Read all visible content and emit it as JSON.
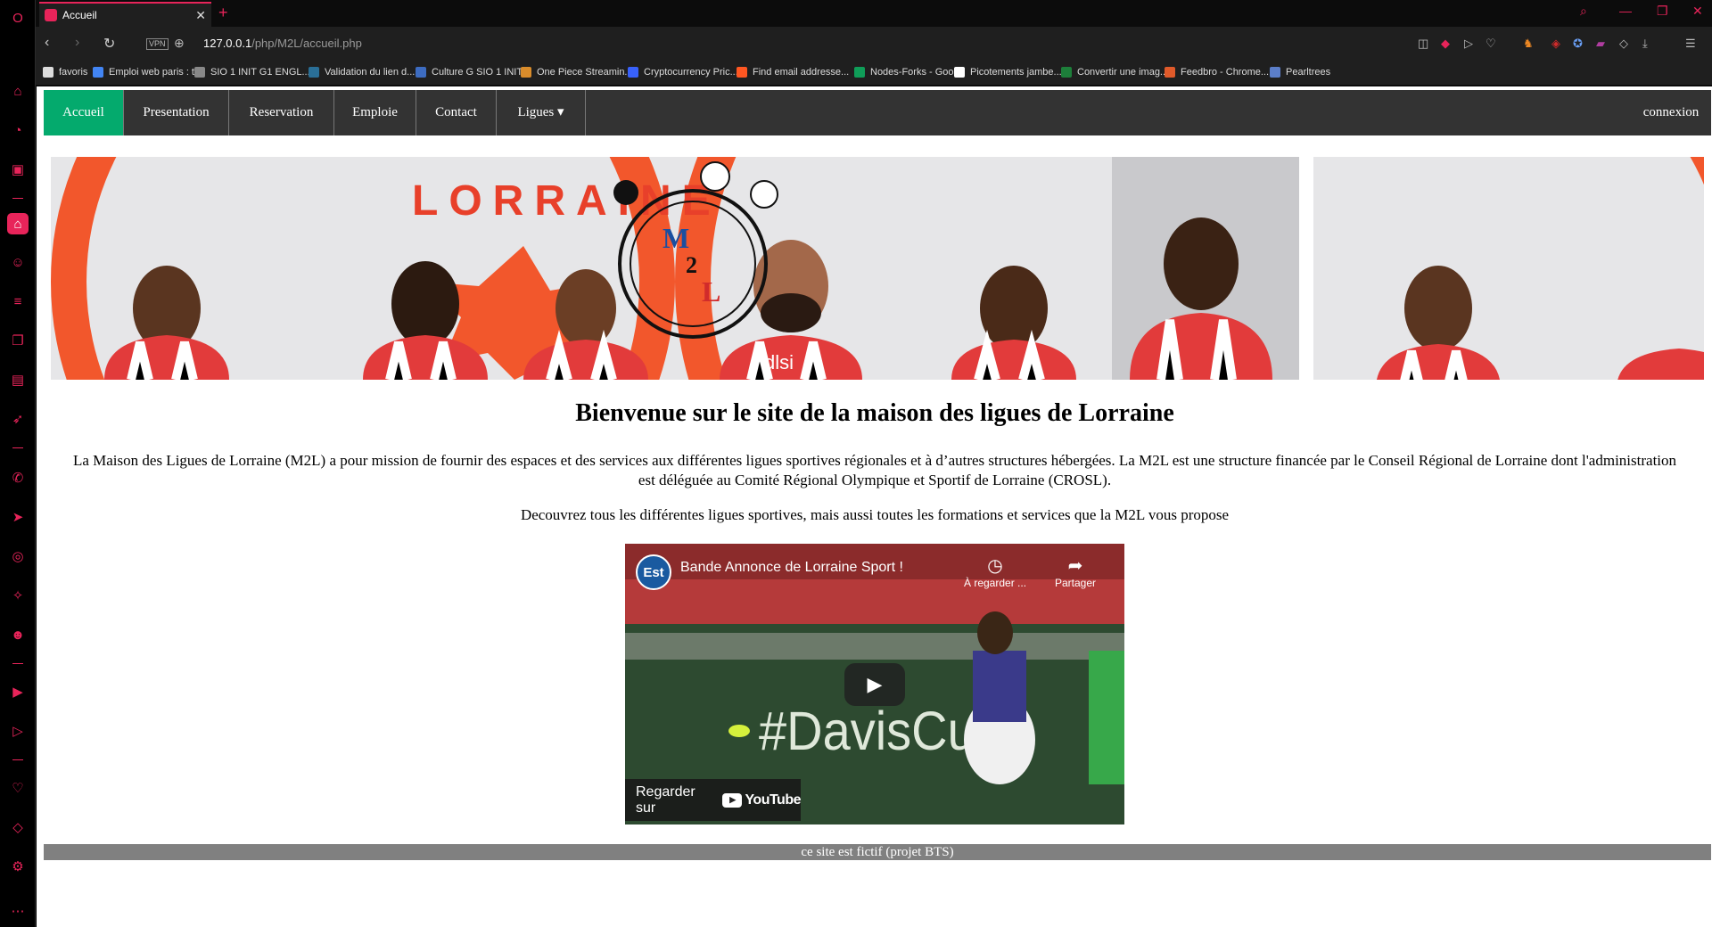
{
  "browser": {
    "tab_title": "Accueil",
    "tab_close": "✕",
    "new_tab": "+",
    "url_host": "127.0.0.1",
    "url_path": "/php/M2L/accueil.php",
    "vpn_label": "VPN"
  },
  "bookmarks": [
    {
      "label": "favoris",
      "icon": "folder-icon",
      "color": "#dddddd"
    },
    {
      "label": "Emploi web paris : t...",
      "icon": "google-icon",
      "color": "#4285f4"
    },
    {
      "label": "SIO 1 INIT G1 ENGL...",
      "icon": "doc-icon",
      "color": "#888888"
    },
    {
      "label": "Validation du lien d...",
      "icon": "s-icon",
      "color": "#2a6f97"
    },
    {
      "label": "Culture G SIO 1 INIT",
      "icon": "people-icon",
      "color": "#3d6cc1"
    },
    {
      "label": "One Piece Streamin...",
      "icon": "op-icon",
      "color": "#d98c2b"
    },
    {
      "label": "Cryptocurrency Pric...",
      "icon": "crypto-icon",
      "color": "#3861fb"
    },
    {
      "label": "Find email addresse...",
      "icon": "hunter-icon",
      "color": "#ff5722"
    },
    {
      "label": "Nodes-Forks - Goo...",
      "icon": "sheets-icon",
      "color": "#0f9d58"
    },
    {
      "label": "Picotements jambe...",
      "icon": "chart-icon",
      "color": "#ffffff"
    },
    {
      "label": "Convertir une imag...",
      "icon": "x-icon",
      "color": "#1d7f3a"
    },
    {
      "label": "Feedbro - Chrome...",
      "icon": "feed-icon",
      "color": "#e05a2a"
    },
    {
      "label": "Pearltrees",
      "icon": "pearl-icon",
      "color": "#5b7ec9"
    }
  ],
  "nav": {
    "items": [
      "Accueil",
      "Presentation",
      "Reservation",
      "Emploie",
      "Contact",
      "Ligues ▾"
    ],
    "login": "connexion"
  },
  "banner": {
    "wall_text": "LORRAINE",
    "logo_letters": [
      "M",
      "2",
      "L"
    ],
    "sponsor": "dlsi"
  },
  "main": {
    "heading": "Bienvenue sur le site de la maison des ligues de Lorraine",
    "intro": "La Maison des Ligues de Lorraine (M2L) a pour mission de fournir des espaces et des services aux différentes ligues sportives régionales et à d’autres structures hébergées. La M2L est une structure financée par le Conseil Régional de Lorraine dont l'administration est déléguée au Comité Régional Olympique et Sportif de Lorraine (CROSL).",
    "discover": "Decouvrez tous les différentes ligues sportives, mais aussi toutes les formations et services que la M2L vous propose"
  },
  "video": {
    "channel_logo": "Est",
    "title": "Bande Annonce de Lorraine Sport !",
    "watch_later": "À regarder ...",
    "share": "Partager",
    "watch_on": "Regarder sur",
    "brand": "YouTube",
    "court_text": "#DavisCup"
  },
  "footer": {
    "text": "ce site est fictif (projet BTS)"
  },
  "colors": {
    "accent": "#e8245a",
    "nav_bg": "#333333",
    "nav_active": "#04AA6D",
    "footer_bg": "#808080"
  }
}
